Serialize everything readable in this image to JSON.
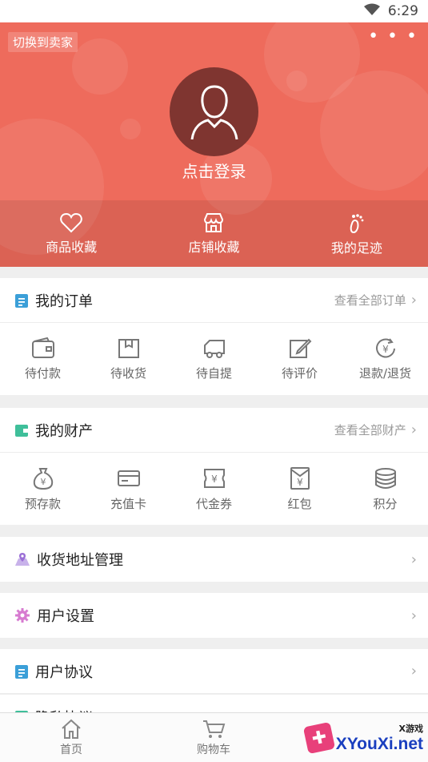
{
  "status": {
    "time": "6:29"
  },
  "header": {
    "switch_label": "切换到卖家",
    "more_label": "• • •",
    "login_label": "点击登录",
    "quick": [
      {
        "label": "商品收藏",
        "icon": "heart-icon"
      },
      {
        "label": "店铺收藏",
        "icon": "store-icon"
      },
      {
        "label": "我的足迹",
        "icon": "footprint-icon"
      }
    ]
  },
  "orders": {
    "title": "我的订单",
    "link": "查看全部订单",
    "items": [
      {
        "label": "待付款",
        "icon": "wallet-icon"
      },
      {
        "label": "待收货",
        "icon": "box-icon"
      },
      {
        "label": "待自提",
        "icon": "truck-icon"
      },
      {
        "label": "待评价",
        "icon": "edit-icon"
      },
      {
        "label": "退款/退货",
        "icon": "refund-icon"
      }
    ]
  },
  "assets": {
    "title": "我的财产",
    "link": "查看全部财产",
    "items": [
      {
        "label": "预存款",
        "icon": "money-bag-icon"
      },
      {
        "label": "充值卡",
        "icon": "card-icon"
      },
      {
        "label": "代金券",
        "icon": "voucher-icon"
      },
      {
        "label": "红包",
        "icon": "red-packet-icon"
      },
      {
        "label": "积分",
        "icon": "coins-icon"
      }
    ]
  },
  "menu": [
    {
      "label": "收货地址管理",
      "icon": "location-icon"
    },
    {
      "label": "用户设置",
      "icon": "gear-icon"
    },
    {
      "label": "用户协议",
      "icon": "document-icon"
    },
    {
      "label": "隐私协议",
      "icon": "document-icon"
    }
  ],
  "tabbar": [
    {
      "label": "首页",
      "icon": "home-icon"
    },
    {
      "label": "购物车",
      "icon": "cart-icon"
    }
  ],
  "watermark": {
    "small": "X游戏",
    "main": "XYouXi.net"
  },
  "colors": {
    "header": "#ee6b5c",
    "avatar": "#7f3530",
    "order_icon": "#3b9fd8",
    "asset_icon": "#3fbf9a",
    "location_icon": "#9b6fd6",
    "gear_icon": "#d77bd0"
  }
}
